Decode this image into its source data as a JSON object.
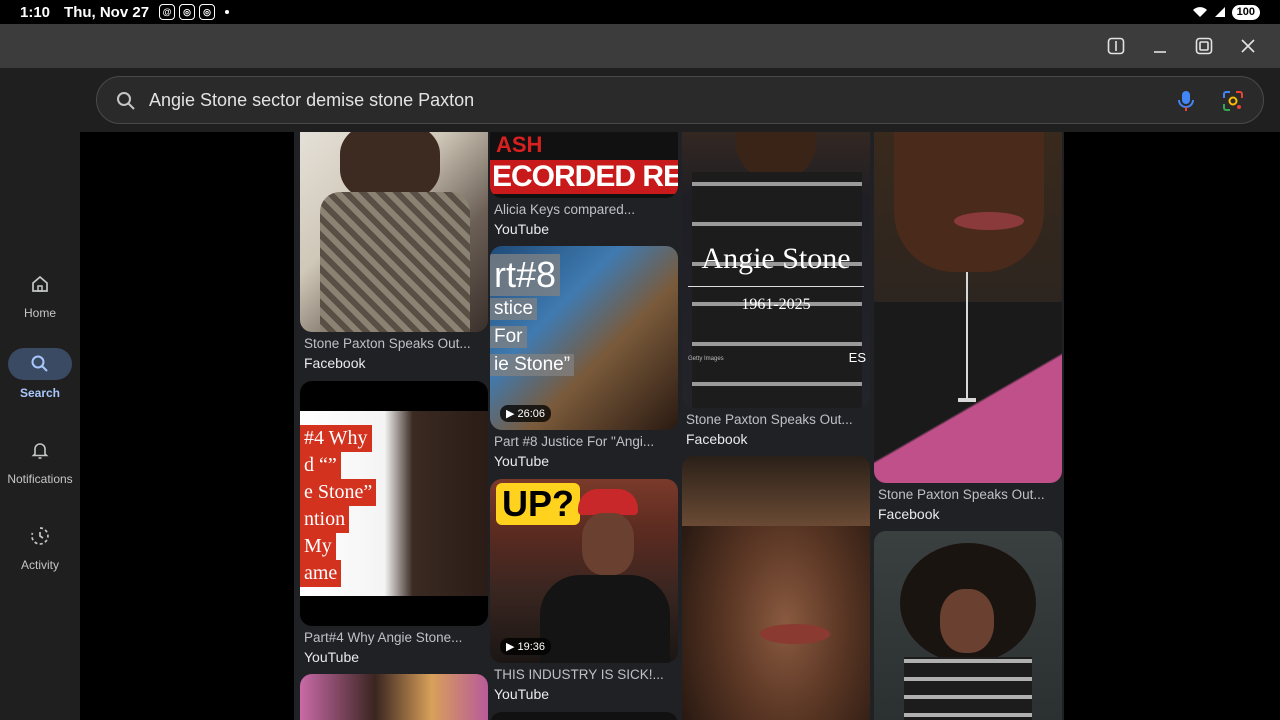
{
  "status": {
    "time": "1:10",
    "date": "Thu, Nov 27",
    "battery": "100"
  },
  "search": {
    "query": "Angie Stone sector demise stone Paxton"
  },
  "nav": [
    {
      "label": "Home",
      "icon": "home-icon"
    },
    {
      "label": "Search",
      "icon": "search-icon",
      "active": true
    },
    {
      "label": "Notifications",
      "icon": "bell-icon"
    },
    {
      "label": "Activity",
      "icon": "activity-icon"
    }
  ],
  "results": [
    {
      "title": "Stone Paxton Speaks Out...",
      "source": "Facebook"
    },
    {
      "title": "Part#4 Why Angie Stone...",
      "source": "YouTube",
      "overlay": [
        "#4 Why",
        "d “”",
        "e Stone”",
        "ntion",
        "My",
        "ame"
      ]
    },
    {
      "title": "Alicia Keys compared...",
      "source": "YouTube",
      "overlay": "ECORDED RECE",
      "overlay_top": "ASH"
    },
    {
      "title": "Part #8 Justice For \"Angi...",
      "source": "YouTube",
      "duration": "26:06",
      "overlay": [
        "rt#8",
        "stice",
        "For",
        "ie Stone”"
      ]
    },
    {
      "title": "THIS INDUSTRY IS SICK!...",
      "source": "YouTube",
      "duration": "19:36",
      "overlay": "UP?"
    },
    {
      "title": "Stone Paxton Speaks Out...",
      "source": "Facebook",
      "overlay": "Angie Stone",
      "years": "1961-2025",
      "corner": "ES",
      "credit": "Getty Images"
    },
    {
      "title": "Stone Paxton Speaks Out...",
      "source": "Facebook"
    }
  ],
  "colors": {
    "accent": "#a8c7fa",
    "nav_active_bg": "#3a4a63",
    "background": "#1f1f1f"
  }
}
